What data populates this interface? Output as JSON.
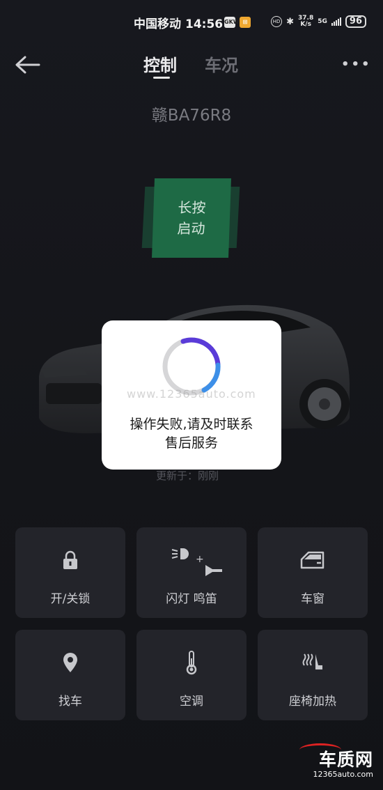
{
  "status_bar": {
    "carrier": "中国移动",
    "time": "14:56",
    "mini_a": "GKW",
    "mini_b": "⊞",
    "hd": "HD",
    "net_speed_top": "37.8",
    "net_speed_unit": "K/s",
    "net_type": "5G",
    "battery": "96"
  },
  "header": {
    "tabs": [
      {
        "label": "控制",
        "active": true
      },
      {
        "label": "车况",
        "active": false
      }
    ],
    "more_label": "•••"
  },
  "vehicle": {
    "plate": "赣BA76R8",
    "start_button_line1": "长按",
    "start_button_line2": "启动",
    "updated": "更新于：刚刚"
  },
  "dialog": {
    "message_line1": "操作失败,请及时联系",
    "message_line2": "售后服务",
    "watermark": "www.12365auto.com"
  },
  "controls": [
    {
      "label": "开/关锁",
      "icon": "lock-icon"
    },
    {
      "label": "闪灯 鸣笛",
      "icon": "flash-horn-icon"
    },
    {
      "label": "车窗",
      "icon": "car-window-icon"
    },
    {
      "label": "找车",
      "icon": "location-pin-icon"
    },
    {
      "label": "空调",
      "icon": "thermometer-icon"
    },
    {
      "label": "座椅加热",
      "icon": "seat-heat-icon"
    }
  ],
  "brand": {
    "name": "车质网",
    "url": "12365auto.com"
  },
  "colors": {
    "background": "#15161c",
    "tile": "#23242a",
    "start_button": "#1e6a45",
    "spinner_accent": "#5a3bd8",
    "spinner_accent2": "#3d8fe8"
  }
}
